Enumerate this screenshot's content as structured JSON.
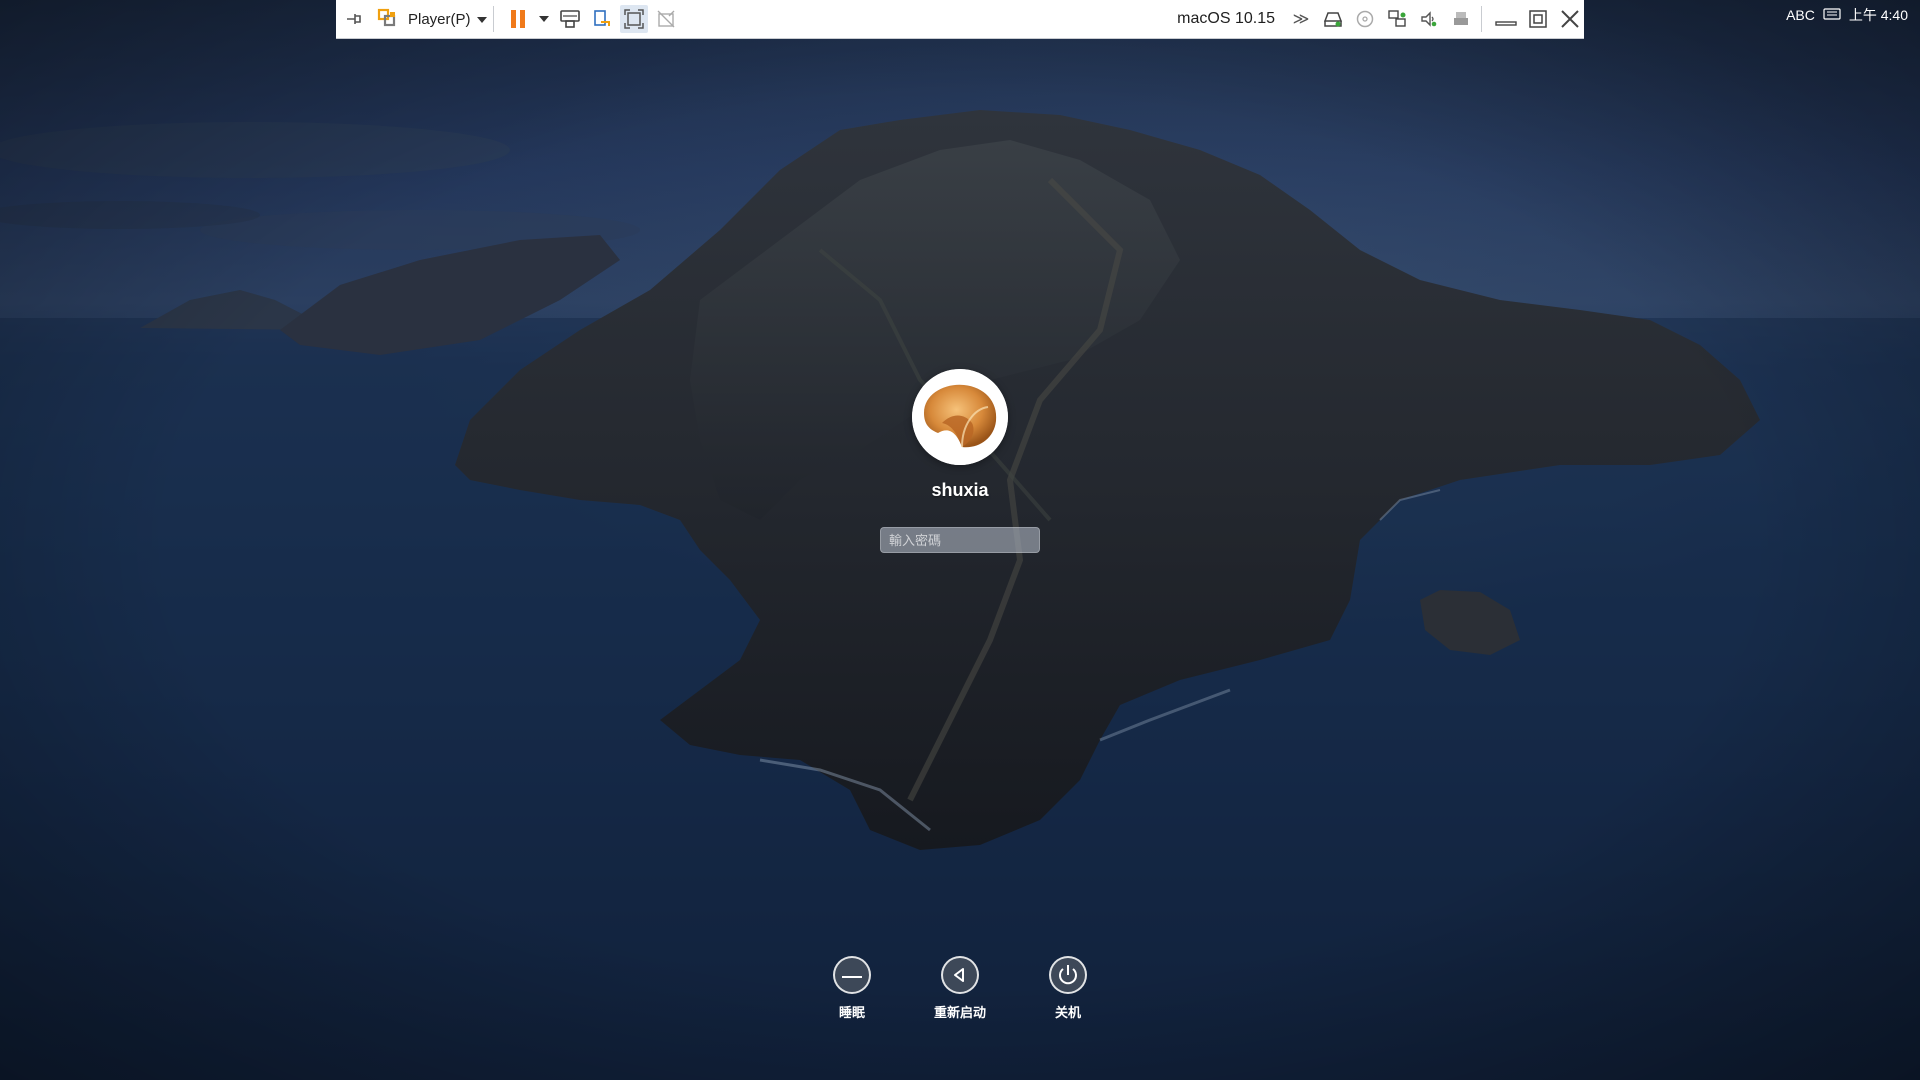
{
  "vm_toolbar": {
    "player_menu_label": "Player(P)",
    "vm_name": "macOS 10.15",
    "more_glyph": "≫"
  },
  "tray": {
    "input_method": "ABC",
    "time": "上午 4:40"
  },
  "login": {
    "username": "shuxia",
    "password_placeholder": "輸入密碼",
    "password_value": ""
  },
  "power": {
    "sleep_label": "睡眠",
    "restart_label": "重新启动",
    "shutdown_label": "关机"
  },
  "colors": {
    "toolbar_bg": "#ffffff",
    "pause_orange": "#f07a1a",
    "sky_dark": "#1c2c47",
    "sea_dark": "#0e1d35"
  }
}
